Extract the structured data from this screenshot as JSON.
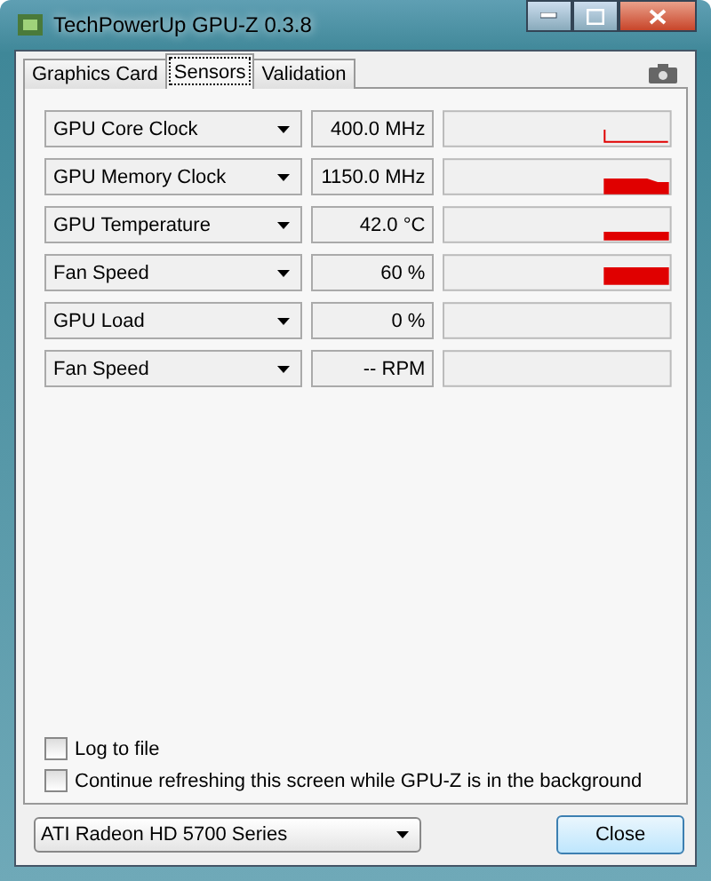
{
  "window": {
    "title": "TechPowerUp GPU-Z 0.3.8"
  },
  "tabs": [
    {
      "label": "Graphics Card",
      "selected": false
    },
    {
      "label": "Sensors",
      "selected": true
    },
    {
      "label": "Validation",
      "selected": false
    }
  ],
  "sensors": [
    {
      "name": "GPU Core Clock",
      "value": "400.0 MHz"
    },
    {
      "name": "GPU Memory Clock",
      "value": "1150.0 MHz"
    },
    {
      "name": "GPU Temperature",
      "value": "42.0 °C"
    },
    {
      "name": "Fan Speed",
      "value": "60 %"
    },
    {
      "name": "GPU Load",
      "value": "0 %"
    },
    {
      "name": "Fan Speed",
      "value": "-- RPM"
    }
  ],
  "options": [
    {
      "label": "Log to file",
      "checked": false
    },
    {
      "label": "Continue refreshing this screen while GPU-Z is in the background",
      "checked": false
    }
  ],
  "device": {
    "value": "ATI Radeon HD 5700 Series"
  },
  "buttons": [
    "Close"
  ]
}
